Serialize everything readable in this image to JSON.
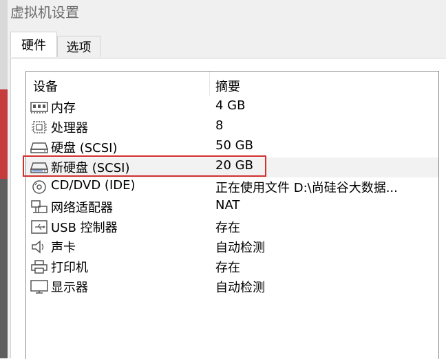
{
  "window": {
    "title": "虚拟机设置"
  },
  "tabs": [
    {
      "label": "硬件",
      "active": true
    },
    {
      "label": "选项",
      "active": false
    }
  ],
  "table": {
    "headers": {
      "device": "设备",
      "summary": "摘要"
    },
    "rows": [
      {
        "icon": "memory-icon",
        "device": "内存",
        "summary": "4 GB"
      },
      {
        "icon": "cpu-icon",
        "device": "处理器",
        "summary": "8"
      },
      {
        "icon": "hard-disk-icon",
        "device": "硬盘 (SCSI)",
        "summary": "50 GB"
      },
      {
        "icon": "hard-disk-icon",
        "device": "新硬盘 (SCSI)",
        "summary": "20 GB",
        "selected": true,
        "highlighted": true
      },
      {
        "icon": "cd-dvd-icon",
        "device": "CD/DVD (IDE)",
        "summary": "正在使用文件 D:\\尚硅谷大数据..."
      },
      {
        "icon": "network-adapter-icon",
        "device": "网络适配器",
        "summary": "NAT"
      },
      {
        "icon": "usb-icon",
        "device": "USB 控制器",
        "summary": "存在"
      },
      {
        "icon": "speaker-icon",
        "device": "声卡",
        "summary": "自动检测"
      },
      {
        "icon": "printer-icon",
        "device": "打印机",
        "summary": "存在"
      },
      {
        "icon": "monitor-icon",
        "device": "显示器",
        "summary": "自动检测"
      }
    ]
  },
  "colors": {
    "highlight_border": "#d32f2f",
    "icon_stroke": "#555555"
  }
}
